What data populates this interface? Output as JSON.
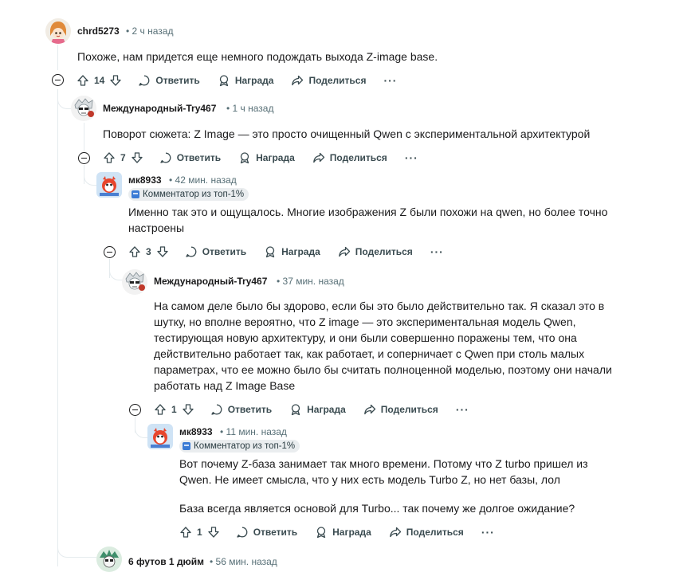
{
  "comments": [
    {
      "username": "chrd5273",
      "time": "• 2 ч назад",
      "body": [
        "Похоже, нам придется еще немного подождать выхода Z-image base."
      ],
      "votes": "14"
    },
    {
      "username": "Международный-Try467",
      "time": "• 1 ч назад",
      "body": [
        "Поворот сюжета: Z Image — это просто очищенный Qwen с экспериментальной архитектурой"
      ],
      "votes": "7"
    },
    {
      "username": "мк8933",
      "time": "• 42 мин. назад",
      "flair": "Комментатор из топ-1%",
      "body": [
        "Именно так это и ощущалось. Многие изображения Z были похожи на qwen, но более точно настроены"
      ],
      "votes": "3"
    },
    {
      "username": "Международный-Try467",
      "time": "• 37 мин. назад",
      "body": [
        "На самом деле было бы здорово, если бы это было действительно так. Я сказал это в шутку, но вполне вероятно, что Z image — это экспериментальная модель Qwen, тестирующая новую архитектуру, и они были совершенно поражены тем, что она действительно работает так, как работает, и соперничает с Qwen при столь малых параметрах, что ее можно было бы считать полноценной моделью, поэтому они начали работать над Z Image Base"
      ],
      "votes": "1"
    },
    {
      "username": "мк8933",
      "time": "• 11 мин. назад",
      "flair": "Комментатор из топ-1%",
      "body": [
        "Вот почему Z-база занимает так много времени. Потому что Z turbo пришел из Qwen. Не имеет смысла, что у них есть модель Turbo Z, но нет базы, лол",
        "База всегда является основой для Turbo... так почему же долгое ожидание?"
      ],
      "votes": "1"
    },
    {
      "username": "6 футов 1 дюйм",
      "time": "• 56 мин. назад"
    }
  ],
  "actions": {
    "reply": "Ответить",
    "award": "Награда",
    "share": "Поделиться",
    "more": "···"
  },
  "icons": {
    "upvote": "arrow-up-icon",
    "downvote": "arrow-down-icon",
    "reply": "speech-bubble-icon",
    "award": "award-icon",
    "share": "share-arrow-icon",
    "collapse": "minus-circle-icon"
  }
}
